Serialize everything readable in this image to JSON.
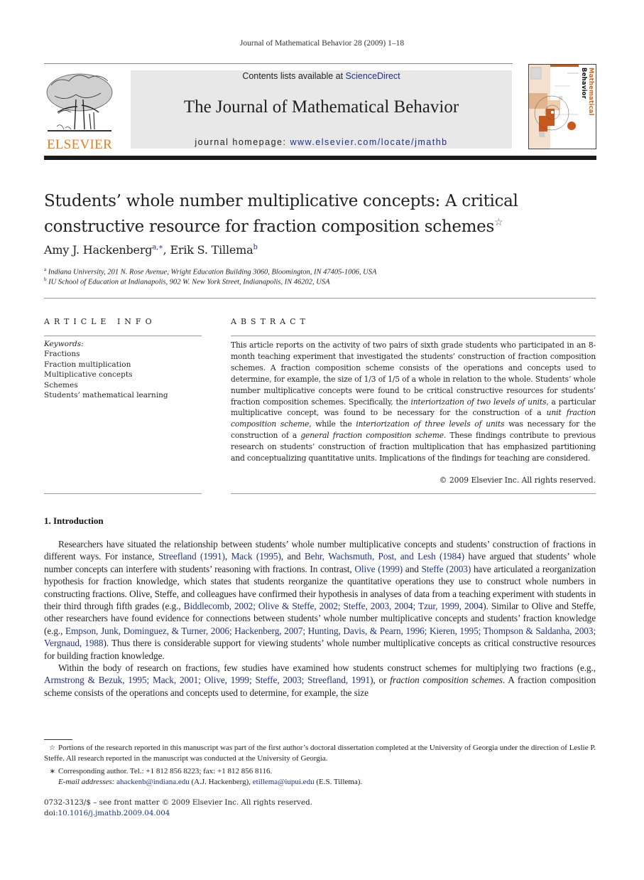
{
  "running_head": "Journal of Mathematical Behavior 28 (2009) 1–18",
  "masthead": {
    "publisher_logo": "ELSEVIER",
    "contents_prefix": "Contents lists available at ",
    "contents_link": "ScienceDirect",
    "journal_title": "The Journal of Mathematical Behavior",
    "homepage_prefix": "journal homepage: ",
    "homepage_link": "www.elsevier.com/locate/jmathb",
    "cover_title_part1": "Mathematical",
    "cover_title_part2": " Behavior",
    "accent_color": "#e87d1e",
    "link_color": "#1f2f8a"
  },
  "article": {
    "title_line1": "Students’ whole number multiplicative concepts: A critical",
    "title_line2": "constructive resource for fraction composition schemes",
    "title_note_mark": "☆",
    "authors": [
      {
        "name": "Amy J. Hackenberg",
        "sup": "a,∗"
      },
      {
        "name": "Erik S. Tillema",
        "sup": "b"
      }
    ],
    "author_separator": ", ",
    "affiliations": [
      {
        "mark": "a",
        "text": "Indiana University, 201 N. Rose Avenue, Wright Education Building 3060, Bloomington, IN 47405-1006, USA"
      },
      {
        "mark": "b",
        "text": "IU School of Education at Indianapolis, 902 W. New York Street, Indianapolis, IN 46202, USA"
      }
    ]
  },
  "article_info": {
    "heading": "ARTICLE INFO",
    "keywords_label": "Keywords:",
    "keywords": [
      "Fractions",
      "Fraction multiplication",
      "Multiplicative concepts",
      "Schemes",
      "Students’ mathematical learning"
    ]
  },
  "abstract": {
    "heading": "ABSTRACT",
    "p1": "This article reports on the activity of two pairs of sixth grade students who participated in an 8-month teaching experiment that investigated the students’ construction of fraction composition schemes. A fraction composition scheme consists of the operations and concepts used to determine, for example, the size of 1/3 of 1/5 of a whole in relation to the whole. Students’ whole number multiplicative concepts were found to be critical constructive resources for students’ fraction composition schemes. Specifically, the ",
    "em1": "interiorization of two levels of units",
    "p2": ", a particular multiplicative concept, was found to be necessary for the construction of a ",
    "em2": "unit fraction composition scheme",
    "p3": ", while the ",
    "em3": "interiorization of three levels of units",
    "p4": " was necessary for the construction of a ",
    "em4": "general fraction composition scheme",
    "p5": ". These findings contribute to previous research on students’ construction of fraction multiplication that has emphasized partitioning and conceptualizing quantitative units. Implications of the findings for teaching are considered.",
    "copyright": "© 2009 Elsevier Inc. All rights reserved."
  },
  "introduction": {
    "heading": "1.  Introduction",
    "para1": [
      {
        "t": "Researchers have situated the relationship between students’ whole number multiplicative concepts and students’ construction of fractions in different ways. For instance, "
      },
      {
        "link": "Streefland (1991)"
      },
      {
        "t": ", "
      },
      {
        "link": "Mack (1995)"
      },
      {
        "t": ", and "
      },
      {
        "link": "Behr, Wachsmuth, Post, and Lesh (1984)"
      },
      {
        "t": " have argued that students’ whole number concepts can interfere with students’ reasoning with fractions. In contrast, "
      },
      {
        "link": "Olive (1999)"
      },
      {
        "t": " and "
      },
      {
        "link": "Steffe (2003)"
      },
      {
        "t": " have articulated a reorganization hypothesis for fraction knowledge, which states that students reorganize the quantitative operations they use to construct whole numbers in constructing fractions. Olive, Steffe, and colleagues have confirmed their hypothesis in analyses of data from a teaching experiment with students in their third through fifth grades (e.g., "
      },
      {
        "link": "Biddlecomb, 2002; Olive & Steffe, 2002; Steffe, 2003, 2004; Tzur, 1999, 2004"
      },
      {
        "t": "). Similar to Olive and Steffe, other researchers have found evidence for connections between students’ whole number multiplicative concepts and students’ fraction knowledge (e.g., "
      },
      {
        "link": "Empson, Junk, Dominguez, & Turner, 2006; Hackenberg, 2007; Hunting, Davis, & Pearn, 1996; Kieren, 1995; Thompson & Saldanha, 2003; Vergnaud, 1988"
      },
      {
        "t": "). Thus there is considerable support for viewing students’ whole number multiplicative concepts as critical constructive resources for building fraction knowledge."
      }
    ],
    "para2": [
      {
        "t": "Within the body of research on fractions, few studies have examined how students construct schemes for multiplying two fractions (e.g., "
      },
      {
        "link": "Armstrong & Bezuk, 1995; Mack, 2001; Olive, 1999; Steffe, 2003; Streefland, 1991"
      },
      {
        "t": "), or "
      },
      {
        "em": "fraction composition schemes"
      },
      {
        "t": ". A fraction composition scheme consists of the operations and concepts used to determine, for example, the size"
      }
    ]
  },
  "footnotes": {
    "star_mark": "☆",
    "star_text": "Portions of the research reported in this manuscript was part of the first author’s doctoral dissertation completed at the University of Georgia under the direction of Leslie P. Steffe. All research reported in the manuscript was conducted at the University of Georgia.",
    "corr_mark": "∗",
    "corr_text": "Corresponding author. Tel.: +1 812 856 8223; fax: +1 812 856 8116.",
    "email_label": "E-mail addresses:",
    "email1": "ahackenb@indiana.edu",
    "email1_owner": " (A.J. Hackenberg), ",
    "email2": "etillema@iupui.edu",
    "email2_owner": " (E.S. Tillema)."
  },
  "bottom_meta": {
    "issn_line": "0732-3123/$ – see front matter © 2009 Elsevier Inc. All rights reserved.",
    "doi_label": "doi:",
    "doi": "10.1016/j.jmathb.2009.04.004"
  }
}
